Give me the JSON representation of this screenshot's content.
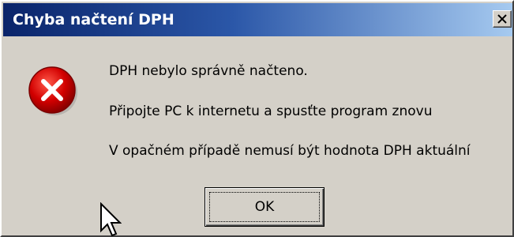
{
  "window": {
    "title": "Chyba načtení DPH",
    "close_icon": "close-icon",
    "title_gradient": [
      "#0a246a",
      "#a6caf0"
    ],
    "background": "#d4d0c8"
  },
  "icon": {
    "name": "error-icon",
    "color": "#d20000"
  },
  "messages": {
    "line1": "DPH nebylo správně načteno.",
    "line2": "Připojte PC k internetu a spusťte program znovu",
    "line3": "V opačném případě nemusí být hodnota DPH aktuální"
  },
  "buttons": {
    "ok_label": "OK"
  },
  "cursor": {
    "name": "arrow-cursor"
  }
}
